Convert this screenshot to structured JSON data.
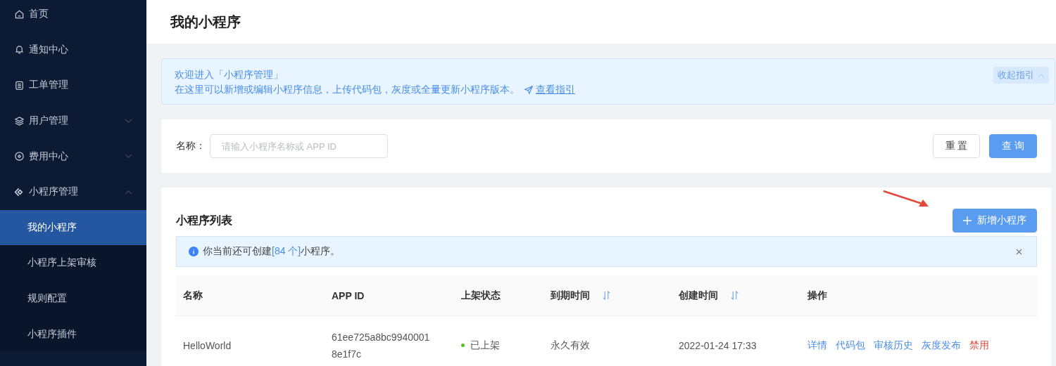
{
  "sidebar": {
    "items": [
      {
        "label": "首页",
        "kind": "home",
        "selected": false
      },
      {
        "label": "通知中心",
        "kind": "bell",
        "selected": false
      },
      {
        "label": "工单管理",
        "kind": "clipboard",
        "selected": false
      },
      {
        "label": "用户管理",
        "kind": "layers",
        "selected": false,
        "expanded": false
      },
      {
        "label": "费用中心",
        "kind": "coin",
        "selected": false,
        "expanded": false
      },
      {
        "label": "小程序管理",
        "kind": "diamond",
        "selected": false,
        "expanded": true,
        "children": [
          {
            "label": "我的小程序",
            "selected": true
          },
          {
            "label": "小程序上架审核",
            "selected": false
          },
          {
            "label": "规则配置",
            "selected": false
          },
          {
            "label": "小程序插件",
            "selected": false
          }
        ]
      }
    ]
  },
  "page_title": "我的小程序",
  "guide": {
    "title": "欢迎进入「小程序管理」",
    "text": "在这里可以新增或编辑小程序信息，上传代码包，灰度或全量更新小程序版本。",
    "link": "查看指引",
    "collapse_button": "收起指引"
  },
  "search": {
    "label": "名称：",
    "placeholder": "请输入小程序名称或 APP ID",
    "buttons": [
      {
        "label": "重 置",
        "kind": "default"
      },
      {
        "label": "查 询",
        "kind": "primary"
      }
    ]
  },
  "list": {
    "title": "小程序列表",
    "add_button": "新增小程序",
    "notice": {
      "before": "你当前还可创建",
      "count": "[84 个]",
      "after": "小程序。"
    },
    "table": {
      "columns": [
        {
          "label": "名称",
          "sortable": false
        },
        {
          "label": "APP ID",
          "sortable": false
        },
        {
          "label": "上架状态",
          "sortable": false
        },
        {
          "label": "到期时间",
          "sortable": true
        },
        {
          "label": "创建时间",
          "sortable": true
        },
        {
          "label": "操作",
          "sortable": false
        }
      ],
      "rows": [
        {
          "name": "HelloWorld",
          "app_id": "61ee725a8bc99400018e1f7c",
          "status": {
            "text": "已上架",
            "color": "#52c41a"
          },
          "expires": "永久有效",
          "created": "2022-01-24 17:33",
          "actions": [
            {
              "label": "详情",
              "kind": "link"
            },
            {
              "label": "代码包",
              "kind": "link"
            },
            {
              "label": "审核历史",
              "kind": "link"
            },
            {
              "label": "灰度发布",
              "kind": "link"
            },
            {
              "label": "禁用",
              "kind": "danger"
            }
          ]
        }
      ]
    }
  }
}
